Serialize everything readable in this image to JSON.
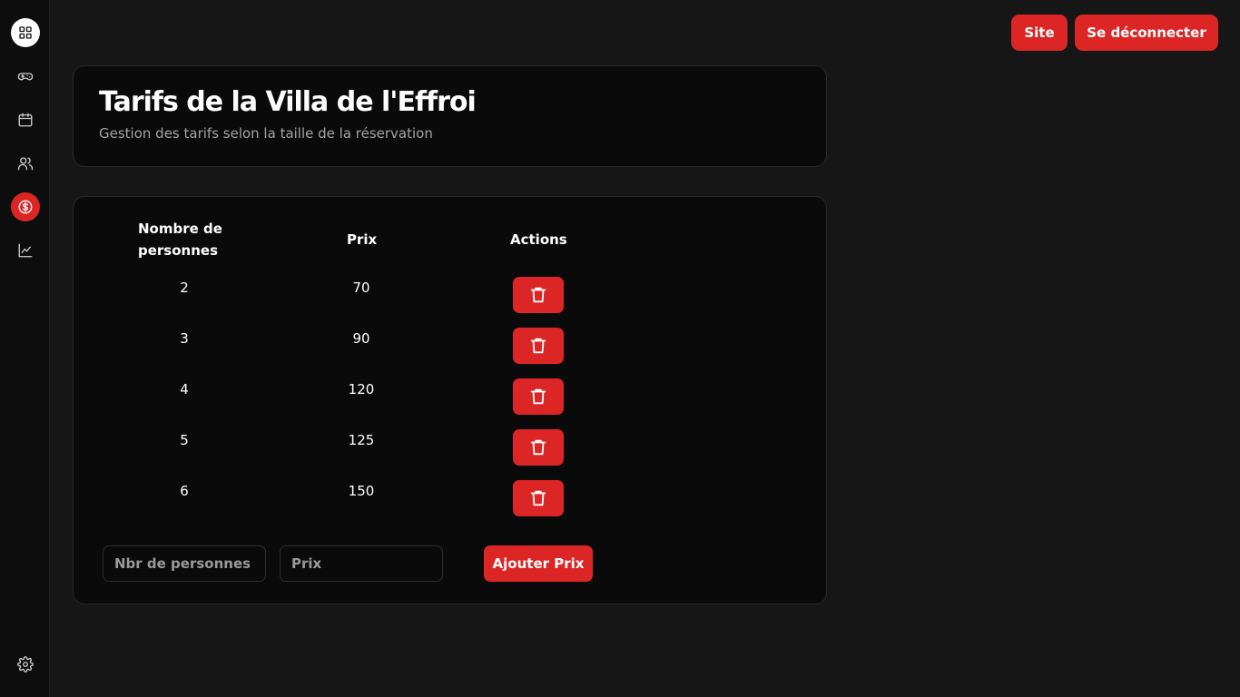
{
  "sidebar": {
    "items": [
      {
        "icon": "dashboard-icon"
      },
      {
        "icon": "gamepad-icon"
      },
      {
        "icon": "calendar-icon"
      },
      {
        "icon": "users-icon"
      },
      {
        "icon": "dollar-icon",
        "active": true
      },
      {
        "icon": "chart-icon"
      },
      {
        "icon": "gear-icon"
      }
    ]
  },
  "topbar": {
    "site_label": "Site",
    "logout_label": "Se déconnecter"
  },
  "header": {
    "title": "Tarifs de la Villa de l'Effroi",
    "subtitle": "Gestion des tarifs selon la taille de la réservation"
  },
  "table": {
    "columns": [
      "Nombre de personnes",
      "Prix",
      "Actions"
    ],
    "rows": [
      {
        "persons": "2",
        "price": "70"
      },
      {
        "persons": "3",
        "price": "90"
      },
      {
        "persons": "4",
        "price": "120"
      },
      {
        "persons": "5",
        "price": "125"
      },
      {
        "persons": "6",
        "price": "150"
      }
    ]
  },
  "form": {
    "persons_placeholder": "Nbr de personnes",
    "price_placeholder": "Prix",
    "add_label": "Ajouter Prix"
  },
  "colors": {
    "accent": "#dc2626",
    "background": "#161616",
    "card": "#0a0a0a"
  }
}
